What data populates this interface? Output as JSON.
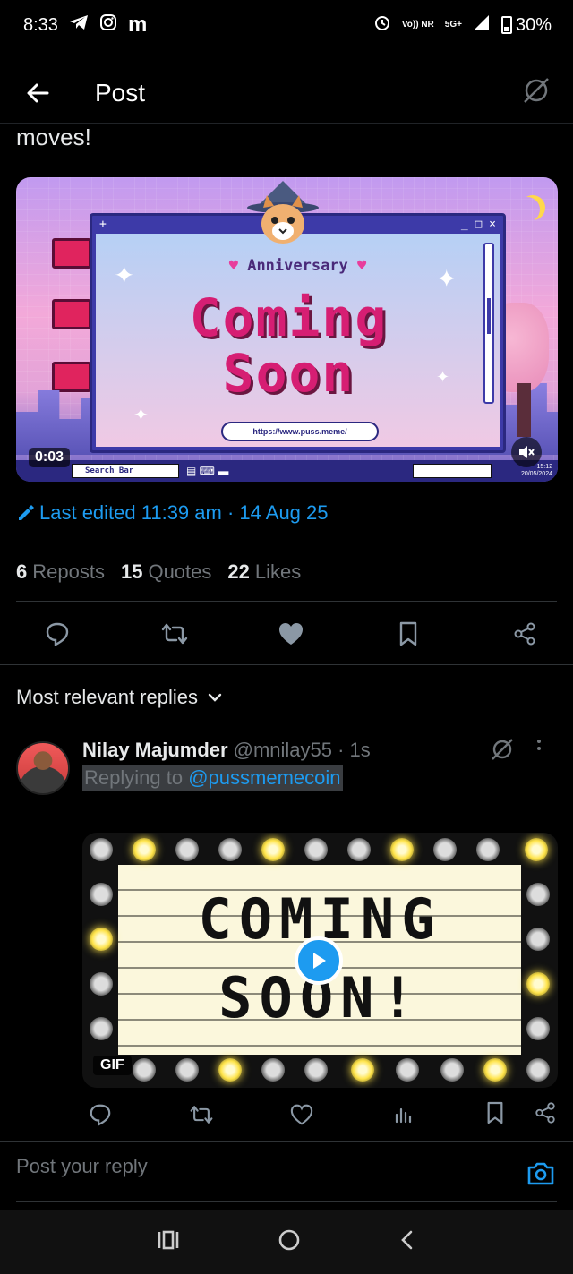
{
  "status_bar": {
    "time": "8:33",
    "network_top": "Vo)) NR",
    "network_5g": "5G+",
    "battery": "30%"
  },
  "header": {
    "title": "Post"
  },
  "post": {
    "text_tail": "moves!",
    "video": {
      "anniversary": "Anniversary",
      "line1": "Coming",
      "line2": "Soon",
      "url": "https://www.puss.meme/",
      "search_bar": "Search Bar",
      "clock_time": "15:12",
      "clock_date": "20/05/2024",
      "elapsed": "0:03"
    },
    "edited": "Last edited 11:39 am · 14 Aug 25",
    "stats": {
      "reposts_count": "6",
      "reposts_label": "Reposts",
      "quotes_count": "15",
      "quotes_label": "Quotes",
      "likes_count": "22",
      "likes_label": "Likes"
    }
  },
  "replies": {
    "sort_label": "Most relevant replies",
    "items": [
      {
        "name": "Nilay Majumder",
        "handle": "@mnilay55 · 1s",
        "replying_prefix": "Replying to",
        "replying_to": "@pussmemecoin",
        "gif": {
          "line1": "COMING",
          "line2": "SOON!",
          "badge": "GIF"
        }
      }
    ]
  },
  "composer": {
    "placeholder": "Post your reply"
  },
  "colors": {
    "accent": "#1d9bf0",
    "background": "#000000",
    "muted": "#71767b"
  }
}
